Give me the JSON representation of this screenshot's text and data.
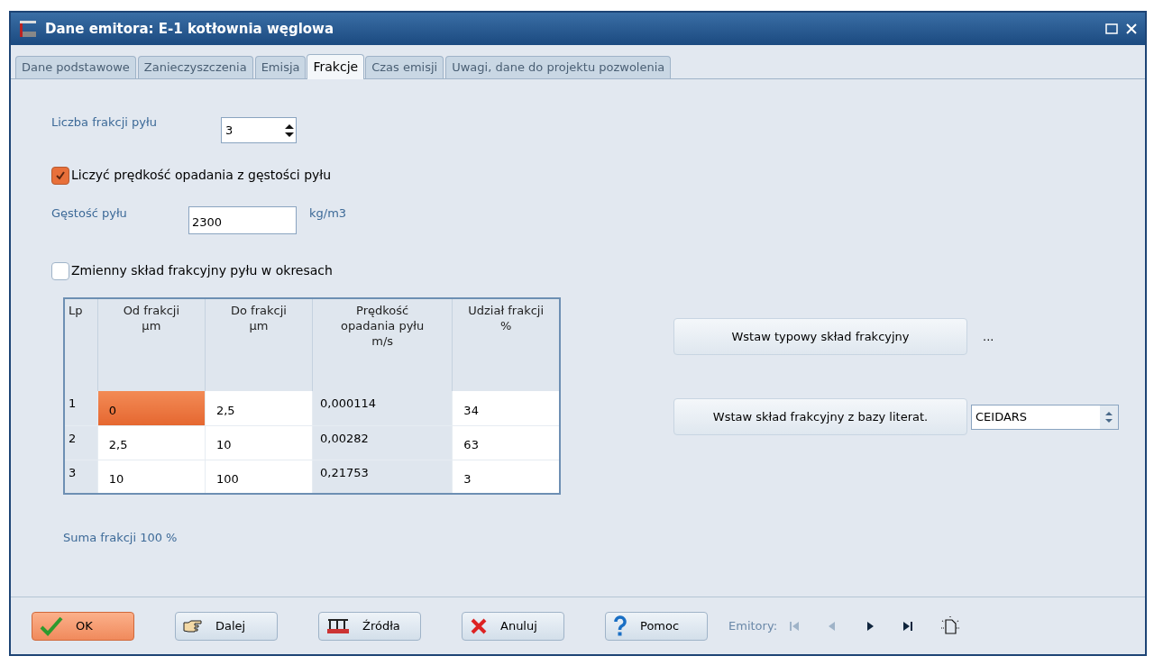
{
  "window": {
    "title": "Dane emitora: E-1 kotłownia węglowa"
  },
  "tabs": [
    {
      "label": "Dane podstawowe",
      "selected": false
    },
    {
      "label": "Zanieczyszczenia",
      "selected": false
    },
    {
      "label": "Emisja",
      "selected": false
    },
    {
      "label": "Frakcje",
      "selected": true
    },
    {
      "label": "Czas emisji",
      "selected": false
    },
    {
      "label": "Uwagi, dane do projektu pozwolenia",
      "selected": false
    }
  ],
  "fraction_count": {
    "label": "Liczba frakcji pyłu",
    "value": "3"
  },
  "compute_velocity": {
    "label": "Liczyć prędkość opadania z gęstości pyłu",
    "checked": true
  },
  "density": {
    "label": "Gęstość pyłu",
    "value": "2300",
    "unit": "kg/m3"
  },
  "variable_composition": {
    "label": "Zmienny skład frakcyjny pyłu w okresach",
    "checked": false
  },
  "table": {
    "columns": [
      {
        "label": "Lp",
        "kind": "index"
      },
      {
        "label": "Od frakcji\nµm",
        "kind": "edit"
      },
      {
        "label": "Do frakcji\nµm",
        "kind": "edit"
      },
      {
        "label": "Prędkość\nopadania pyłu\nm/s",
        "kind": "readonly"
      },
      {
        "label": "Udział frakcji\n%",
        "kind": "edit"
      }
    ],
    "rows": [
      {
        "cells": [
          {
            "text": "1",
            "selected": false
          },
          {
            "text": "0",
            "selected": true
          },
          {
            "text": "2,5",
            "selected": false
          },
          {
            "text": "0,000114",
            "selected": false
          },
          {
            "text": "34",
            "selected": false
          }
        ]
      },
      {
        "cells": [
          {
            "text": "2",
            "selected": false
          },
          {
            "text": "2,5",
            "selected": false
          },
          {
            "text": "10",
            "selected": false
          },
          {
            "text": "0,00282",
            "selected": false
          },
          {
            "text": "63",
            "selected": false
          }
        ]
      },
      {
        "cells": [
          {
            "text": "3",
            "selected": false
          },
          {
            "text": "10",
            "selected": false
          },
          {
            "text": "100",
            "selected": false
          },
          {
            "text": "0,21753",
            "selected": false
          },
          {
            "text": "3",
            "selected": false
          }
        ]
      }
    ]
  },
  "sum_label": "Suma frakcji 100 %",
  "typical_button": {
    "label": "Wstaw typowy skład frakcyjny",
    "extra": "..."
  },
  "literature_button": {
    "label": "Wstaw skład frakcyjny z bazy literat.",
    "select_value": "CEIDARS"
  },
  "footer": {
    "buttons": [
      {
        "label": "OK",
        "kind": "ok"
      },
      {
        "label": "Dalej",
        "kind": "next"
      },
      {
        "label": "Źródła",
        "kind": "sources"
      },
      {
        "label": "Anuluj",
        "kind": "cancel"
      },
      {
        "label": "Pomoc",
        "kind": "help"
      }
    ],
    "nav_label": "Emitory:",
    "nav": [
      {
        "kind": "first",
        "disabled": true
      },
      {
        "kind": "prev",
        "disabled": true
      },
      {
        "kind": "next",
        "disabled": false
      },
      {
        "kind": "last",
        "disabled": false
      }
    ]
  }
}
